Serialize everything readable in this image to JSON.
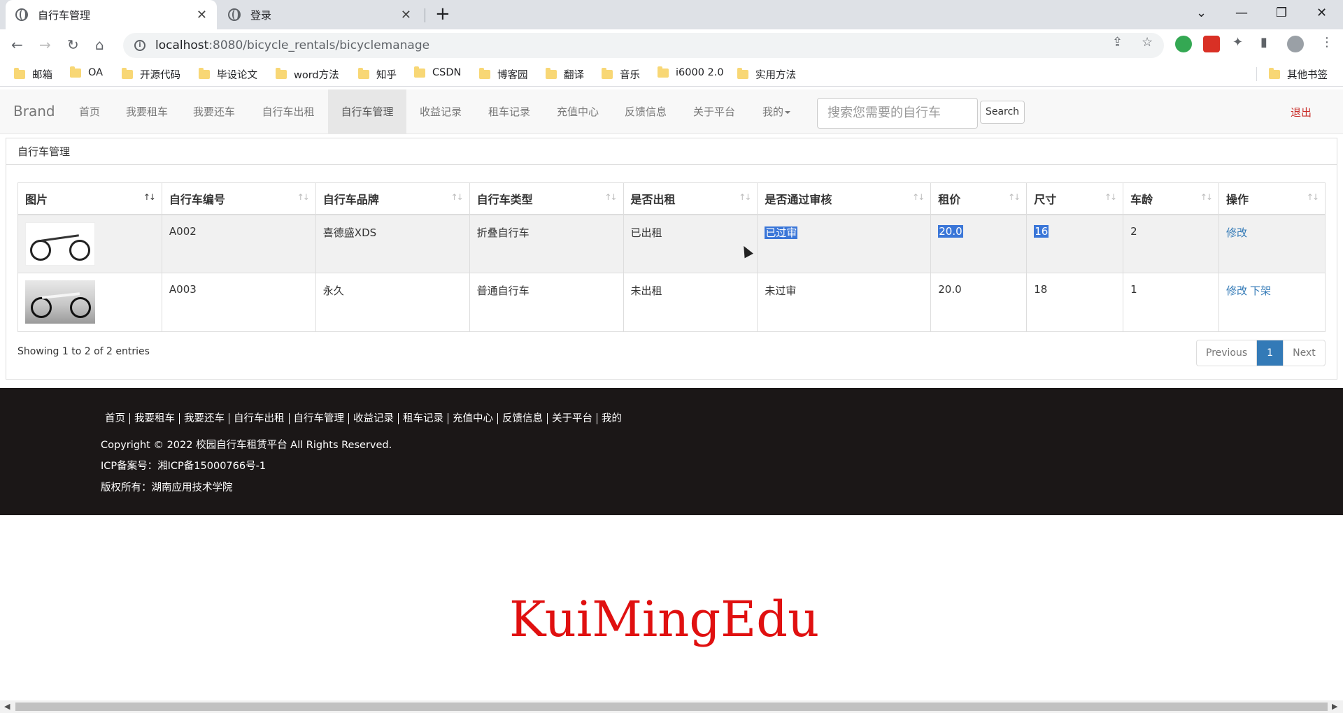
{
  "browser": {
    "tabs": [
      {
        "title": "自行车管理"
      },
      {
        "title": "登录"
      }
    ],
    "url_host": "localhost",
    "url_path": ":8080/bicycle_rentals/bicyclemanage",
    "bookmarks": [
      "邮箱",
      "OA",
      "开源代码",
      "毕设论文",
      "word方法",
      "知乎",
      "CSDN",
      "博客园",
      "翻译",
      "音乐",
      "i6000 2.0",
      "实用方法"
    ],
    "other_bookmarks": "其他书签"
  },
  "navbar": {
    "brand": "Brand",
    "items": [
      "首页",
      "我要租车",
      "我要还车",
      "自行车出租",
      "自行车管理",
      "收益记录",
      "租车记录",
      "充值中心",
      "反馈信息",
      "关于平台",
      "我的"
    ],
    "search_placeholder": "搜索您需要的自行车",
    "search_button": "Search",
    "logout": "退出"
  },
  "panel": {
    "heading": "自行车管理",
    "columns": [
      "图片",
      "自行车编号",
      "自行车品牌",
      "自行车类型",
      "是否出租",
      "是否通过审核",
      "租价",
      "尺寸",
      "车龄",
      "操作"
    ],
    "rows": [
      {
        "id": "A002",
        "brand": "喜德盛XDS",
        "type": "折叠自行车",
        "rented": "已出租",
        "approved": "已过审",
        "price": "20.0",
        "size": "16",
        "age": "2",
        "actions": [
          "修改"
        ]
      },
      {
        "id": "A003",
        "brand": "永久",
        "type": "普通自行车",
        "rented": "未出租",
        "approved": "未过审",
        "price": "20.0",
        "size": "18",
        "age": "1",
        "actions": [
          "修改",
          "下架"
        ]
      }
    ],
    "entries": "Showing 1 to 2 of 2 entries",
    "pager": {
      "prev": "Previous",
      "current": "1",
      "next": "Next"
    }
  },
  "footer": {
    "links": [
      "首页",
      "我要租车",
      "我要还车",
      "自行车出租",
      "自行车管理",
      "收益记录",
      "租车记录",
      "充值中心",
      "反馈信息",
      "关于平台",
      "我的"
    ],
    "copyright": "Copyright © 2022 校园自行车租赁平台 All Rights Reserved.",
    "icp": "ICP备案号：湘ICP备15000766号-1",
    "owner": "版权所有：湖南应用技术学院"
  },
  "watermark": "KuiMingEdu",
  "colors": {
    "link": "#337ab7",
    "logout": "#c9302c",
    "footer_bg": "#1b1717",
    "watermark": "#e01010",
    "selection": "#3a76d8"
  }
}
